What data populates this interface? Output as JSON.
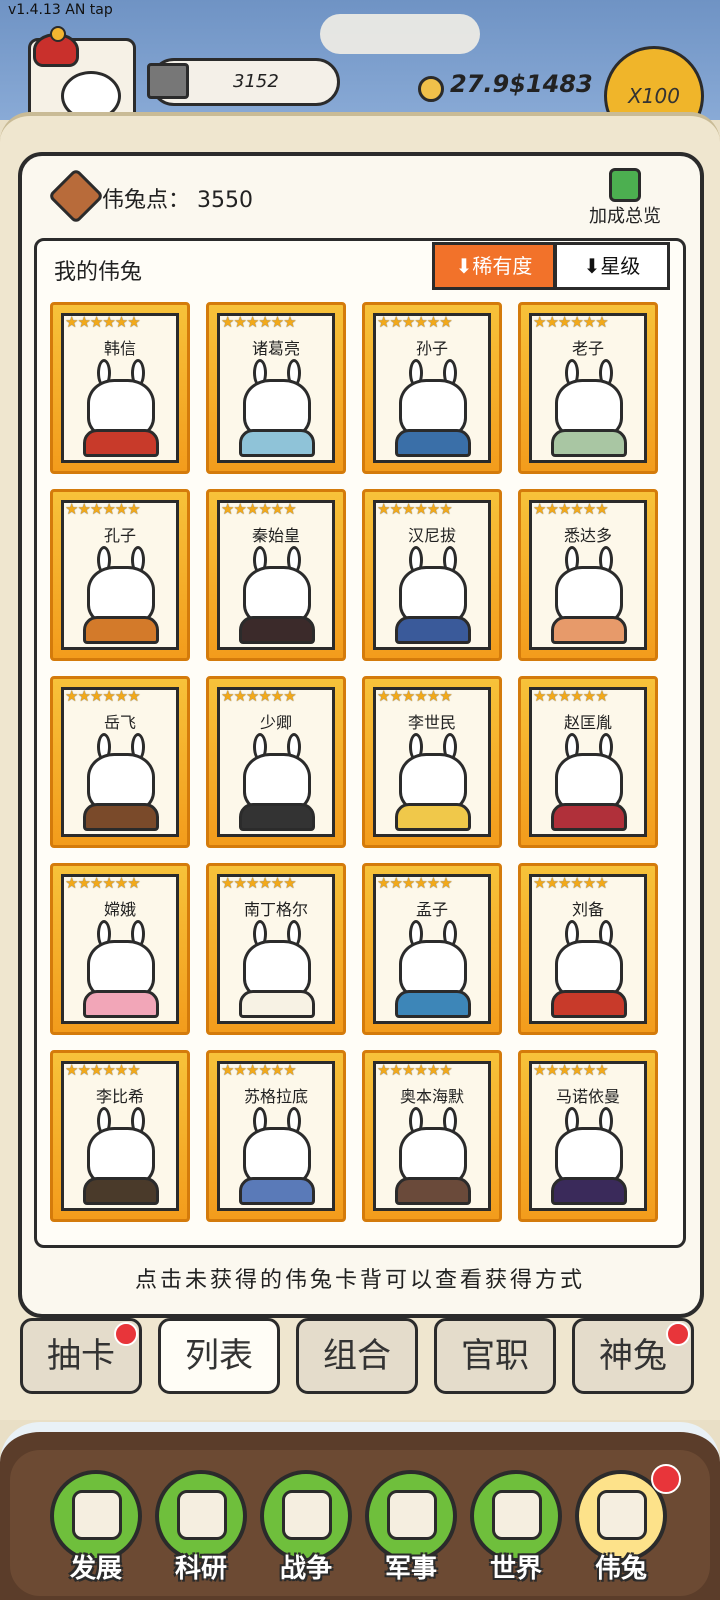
{
  "version": "v1.4.13 AN tap",
  "top": {
    "stone_value": "3152",
    "coin_value": "27.9$1483",
    "multiplier": "X100"
  },
  "panel": {
    "points_label": "伟兔点：  3550",
    "bonus_label": "加成总览",
    "list_title": "我的伟兔",
    "sort_rarity": "⬇稀有度",
    "sort_star": "⬇星级",
    "hint": "点击未获得的伟兔卡背可以查看获得方式"
  },
  "cards": [
    {
      "name": "韩信",
      "stars": "★★★★★★",
      "color": "#c83a2a"
    },
    {
      "name": "诸葛亮",
      "stars": "★★★★★★",
      "color": "#8fc3d8"
    },
    {
      "name": "孙子",
      "stars": "★★★★★★",
      "color": "#3a6fa8"
    },
    {
      "name": "老子",
      "stars": "★★★★★★",
      "color": "#a9c6a3"
    },
    {
      "name": "孔子",
      "stars": "★★★★★★",
      "color": "#d37a2a"
    },
    {
      "name": "秦始皇",
      "stars": "★★★★★★",
      "color": "#3b2a2a"
    },
    {
      "name": "汉尼拔",
      "stars": "★★★★★★",
      "color": "#3a5a9a"
    },
    {
      "name": "悉达多",
      "stars": "★★★★★★",
      "color": "#e79a6a"
    },
    {
      "name": "岳飞",
      "stars": "★★★★★★",
      "color": "#7a4a2a"
    },
    {
      "name": "少卿",
      "stars": "★★★★★★",
      "color": "#333333"
    },
    {
      "name": "李世民",
      "stars": "★★★★★★",
      "color": "#f0c84a"
    },
    {
      "name": "赵匡胤",
      "stars": "★★★★★★",
      "color": "#b0303a"
    },
    {
      "name": "嫦娥",
      "stars": "★★★★★★",
      "color": "#f2a6b8"
    },
    {
      "name": "南丁格尔",
      "stars": "★★★★★★",
      "color": "#f7f2e4"
    },
    {
      "name": "孟子",
      "stars": "★★★★★★",
      "color": "#3d86b8"
    },
    {
      "name": "刘备",
      "stars": "★★★★★★",
      "color": "#c83a2a"
    },
    {
      "name": "李比希",
      "stars": "★★★★★★",
      "color": "#4a3a2a"
    },
    {
      "name": "苏格拉底",
      "stars": "★★★★★★",
      "color": "#5a7ab8"
    },
    {
      "name": "奥本海默",
      "stars": "★★★★★★",
      "color": "#6a4a3a"
    },
    {
      "name": "马诺依曼",
      "stars": "★★★★★★",
      "color": "#3a2a5a"
    }
  ],
  "tabs": [
    {
      "label": "抽卡",
      "active": false,
      "badge": true
    },
    {
      "label": "列表",
      "active": true,
      "badge": false
    },
    {
      "label": "组合",
      "active": false,
      "badge": false
    },
    {
      "label": "官职",
      "active": false,
      "badge": false
    },
    {
      "label": "神兔",
      "active": false,
      "badge": true
    }
  ],
  "nav": [
    {
      "label": "发展",
      "icon": "pickaxe-icon",
      "active": false
    },
    {
      "label": "科研",
      "icon": "flask-icon",
      "active": false
    },
    {
      "label": "战争",
      "icon": "swords-icon",
      "active": false
    },
    {
      "label": "军事",
      "icon": "helmet-icon",
      "active": false
    },
    {
      "label": "世界",
      "icon": "globe-icon",
      "active": false
    },
    {
      "label": "伟兔",
      "icon": "bunny-card-icon",
      "active": true,
      "badge": true
    }
  ]
}
